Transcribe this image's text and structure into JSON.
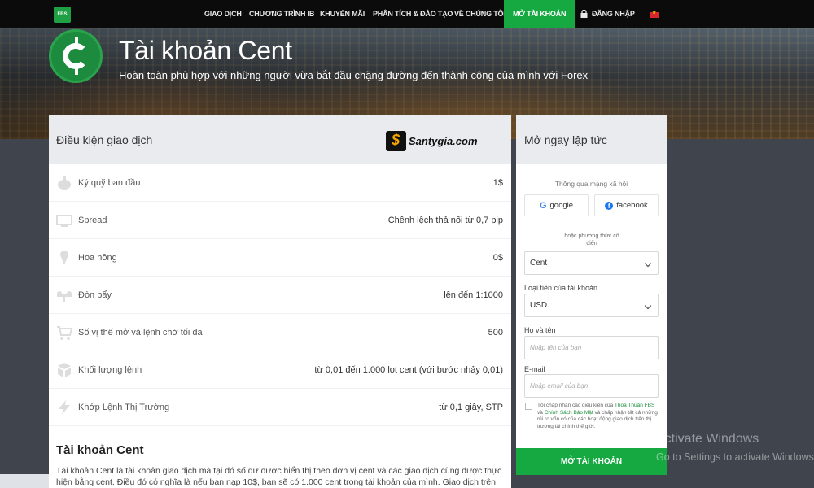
{
  "nav": {
    "items": [
      "GIAO DỊCH",
      "CHƯƠNG TRÌNH IB",
      "KHUYẾN MÃI",
      "PHÂN TÍCH & ĐÀO TẠO",
      "VỀ CHÚNG TÔI"
    ],
    "logo": "FBS",
    "cta": "MỞ TÀI KHOẢN",
    "login": "ĐĂNG NHẬP",
    "accent": "#16a942"
  },
  "hero": {
    "title": "Tài khoản Cent",
    "subtitle": "Hoàn toàn phù hợp với những người vừa bắt đầu chặng đường đến thành công của mình với Forex"
  },
  "conditions": {
    "heading": "Điều kiện giao dịch",
    "watermark": "Santygia.com",
    "rows": [
      {
        "icon": "piggy-bank-icon",
        "label": "Ký quỹ ban đầu",
        "value": "1$"
      },
      {
        "icon": "monitor-icon",
        "label": "Spread",
        "value": "Chênh lệch thả nổi từ 0,7 pip"
      },
      {
        "icon": "ice-cream-icon",
        "label": "Hoa hồng",
        "value": "0$"
      },
      {
        "icon": "scale-icon",
        "label": "Đòn bẩy",
        "value": "lên đến 1:1000"
      },
      {
        "icon": "cart-icon",
        "label": "Số vị thế mở và lệnh chờ tối đa",
        "value": "500"
      },
      {
        "icon": "boxes-icon",
        "label": "Khối lượng lệnh",
        "value": "từ 0,01 đến 1.000 lot cent (với bước nhảy 0,01)"
      },
      {
        "icon": "lightning-icon",
        "label": "Khớp Lệnh Thị Trường",
        "value": "từ 0,1 giây, STP"
      }
    ]
  },
  "description": {
    "title": "Tài khoản Cent",
    "text": "Tài khoản Cent là tài khoản giao dịch mà tại đó số dư được hiển thị theo đơn vị cent và các giao dịch cũng được thực hiện bằng cent. Điều đó có nghĩa là nếu bạn nạp 10$, bạn sẽ có 1.000 cent trong tài khoản của mình. Giao dịch trên tài khoản Cent"
  },
  "signup": {
    "heading": "Mở ngay lập tức",
    "social_caption": "Thông qua mạng xã hội",
    "google": "google",
    "facebook": "facebook",
    "or_text": "hoặc phương thức cổ điển",
    "account_type": "Cent",
    "currency_label": "Loại tiền của tài khoản",
    "currency": "USD",
    "name_label": "Họ và tên",
    "name_placeholder": "Nhập tên của bạn",
    "email_label": "E-mail",
    "email_placeholder": "Nhập email của bạn",
    "terms_a": "Tôi chấp nhận các điều kiện của ",
    "terms_link1": "Thỏa Thuận FBS",
    "terms_b": " và ",
    "terms_link2": "Chính Sách Bảo Mật",
    "terms_c": " và chấp nhận tất cả những rủi ro vốn có của các hoạt động giao dịch trên thị trường tài chính thế giới.",
    "submit": "MỞ TÀI KHOẢN"
  },
  "os_watermark": {
    "line1": "Activate Windows",
    "line2": "Go to Settings to activate Windows."
  }
}
